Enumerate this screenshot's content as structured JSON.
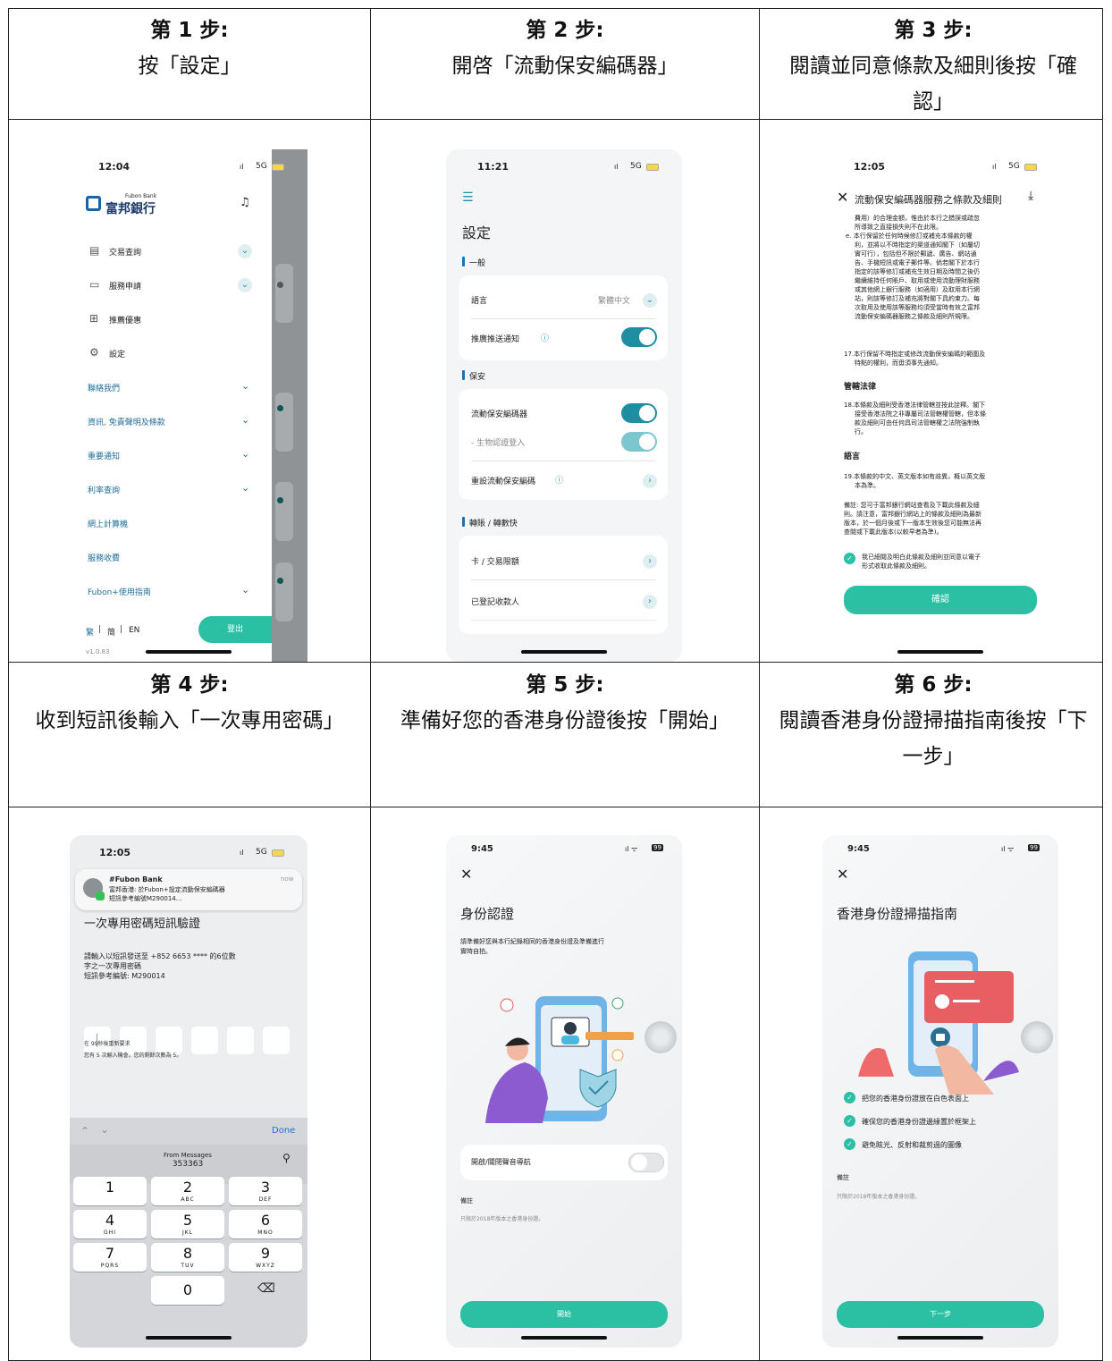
{
  "headers": [
    {
      "step": "第 1 步:",
      "text": "按「設定」"
    },
    {
      "step": "第 2 步:",
      "text": "開啓「流動保安編碼器」"
    },
    {
      "step": "第 3 步:",
      "text": "閱讀並同意條款及細則後按「確認」"
    },
    {
      "step": "第 4 步:",
      "text": "收到短訊後輸入「一次專用密碼」"
    },
    {
      "step": "第 5 步:",
      "text": "準備好您的香港身份證後按「開始」"
    },
    {
      "step": "第 6 步:",
      "text": "閱讀香港身份證掃描指南後按「下一步」"
    }
  ],
  "s1": {
    "time": "12:04",
    "signal": "5G",
    "bank_en": "Fubon Bank",
    "bank_zh": "富邦銀行",
    "menu": [
      "交易查詢",
      "服務申請",
      "推薦優惠",
      "設定"
    ],
    "links": [
      "聯絡我們",
      "資訊, 免責聲明及條款",
      "重要通知",
      "利率查詢",
      "網上計算機",
      "服務收費",
      "Fubon+使用指南"
    ],
    "lang": [
      "繁",
      "简",
      "EN"
    ],
    "logout": "登出",
    "version": "v1.0.83",
    "bg_snips": [
      "ë",
      "ŀ",
      "ʃl)",
      "ʃl)",
      "ʃl)",
      "ʃl)"
    ]
  },
  "s2": {
    "time": "11:21",
    "signal": "5G",
    "title": "設定",
    "sec_general": "一般",
    "language_label": "語言",
    "language_value": "繁體中文",
    "push_label": "推廣推送通知",
    "sec_security": "保安",
    "token_label": "流動保安編碼器",
    "bio_label": "- 生物認證登入",
    "reset_label": "重設流動保安編碼",
    "sec_transfer": "轉賬 / 轉數快",
    "card_limit": "卡 / 交易限額",
    "payees": "已登記收款人"
  },
  "s3": {
    "time": "12:05",
    "signal": "5G",
    "title": "流動保安編碼器服務之條款及細則",
    "para_e": [
      "費用）的合理金額，惟由於本行之錯誤或疏忽",
      "所導致之直接損失則不在此限。",
      "e.  本行保留於任何時候修訂或補充本條款的權",
      "利，並將以不時指定的渠道通知閣下（如屬切",
      "實可行），包括但不限於郵遞、廣告、網站通",
      "告、手機短訊或電子郵件等。倘若閣下於本行",
      "指定的該等修訂或補充生效日期及時間之後仍",
      "繼續維持任何賬戶、取用或使用流動理財服務",
      "或其他網上銀行服務（如適用）及取用本行網",
      "站，則該等修訂及補充將對閣下具約束力。每",
      "次取用及使用該等服務均須受當時有效之富邦",
      "流動保安編碼器服務之條款及細則所規限。"
    ],
    "para_17": [
      "17.本行保留不時指定或修改流動保安編碼的範圍及",
      "特點的權利，而毋須事先通知。"
    ],
    "law_title": "管轄法律",
    "para_18": [
      "18.本條款及細則受香港法律管轄並按此詮釋。閣下",
      "接受香港法院之非專屬司法管轄權管轄，但本條",
      "款及細則可由任何具司法管轄權之法院強制執",
      "行。"
    ],
    "lang_title": "語言",
    "para_19": [
      "19.本條款的中文、英文版本如有歧異，概以英文版",
      "本為準。"
    ],
    "note": [
      "備註: 您可于富邦銀行網站查看及下載此條款及細",
      "則。請注意，富邦銀行網站上的條款及細則為最新",
      "版本，於一個月後或下一版本生效後您可能無法再",
      "查閱或下載此版本(以較早者為準)。"
    ],
    "agree": [
      "我已細閱及明白此條款及細則並同意以電子",
      "形式收取此條款及細則。"
    ],
    "confirm": "確認"
  },
  "s4": {
    "time": "12:05",
    "signal": "5G",
    "notif_app": "#Fubon Bank",
    "notif_time": "now",
    "notif_line1": "富邦香港: 於Fubon+設定流動保安編碼器",
    "notif_line2": "短訊參考編號M290014...",
    "title": "一次專用密碼短訊驗證",
    "desc": [
      "請輸入以短訊發送至 +852 6653 **** 的6位數",
      "字之一次專用密碼",
      "短訊參考編號: M290014"
    ],
    "resend": "在 99秒後重新要求",
    "attempts": "您有 5 次輸入機會。您的剩餘次數為 5。",
    "done": "Done",
    "from_messages": "From Messages",
    "code": "353363",
    "keys": [
      {
        "n": "1",
        "l": ""
      },
      {
        "n": "2",
        "l": "ABC"
      },
      {
        "n": "3",
        "l": "DEF"
      },
      {
        "n": "4",
        "l": "GHI"
      },
      {
        "n": "5",
        "l": "JKL"
      },
      {
        "n": "6",
        "l": "MNO"
      },
      {
        "n": "7",
        "l": "PQRS"
      },
      {
        "n": "8",
        "l": "TUV"
      },
      {
        "n": "9",
        "l": "WXYZ"
      },
      {
        "n": "0",
        "l": ""
      }
    ],
    "delete_key": "⌫"
  },
  "s5": {
    "time": "9:45",
    "battery": "99",
    "title": "身份認證",
    "desc": [
      "請準備好您與本行紀錄相同的香港身份證及準備進行",
      "實時自拍。"
    ],
    "voice_label": "開啟/關閉聲音導航",
    "note_title": "備註",
    "note_text": "只限於2018年版本之香港身份證。",
    "start": "開始"
  },
  "s6": {
    "time": "9:45",
    "battery": "99",
    "title": "香港身份證掃描指南",
    "tips": [
      "把您的香港身份證放在白色表面上",
      "確保您的香港身份證邊緣置於框架上",
      "避免眩光、反射和裁剪過的圖像"
    ],
    "note_title": "備註",
    "note_text": "只限於2018年版本之香港身份證。",
    "next": "下一步"
  }
}
